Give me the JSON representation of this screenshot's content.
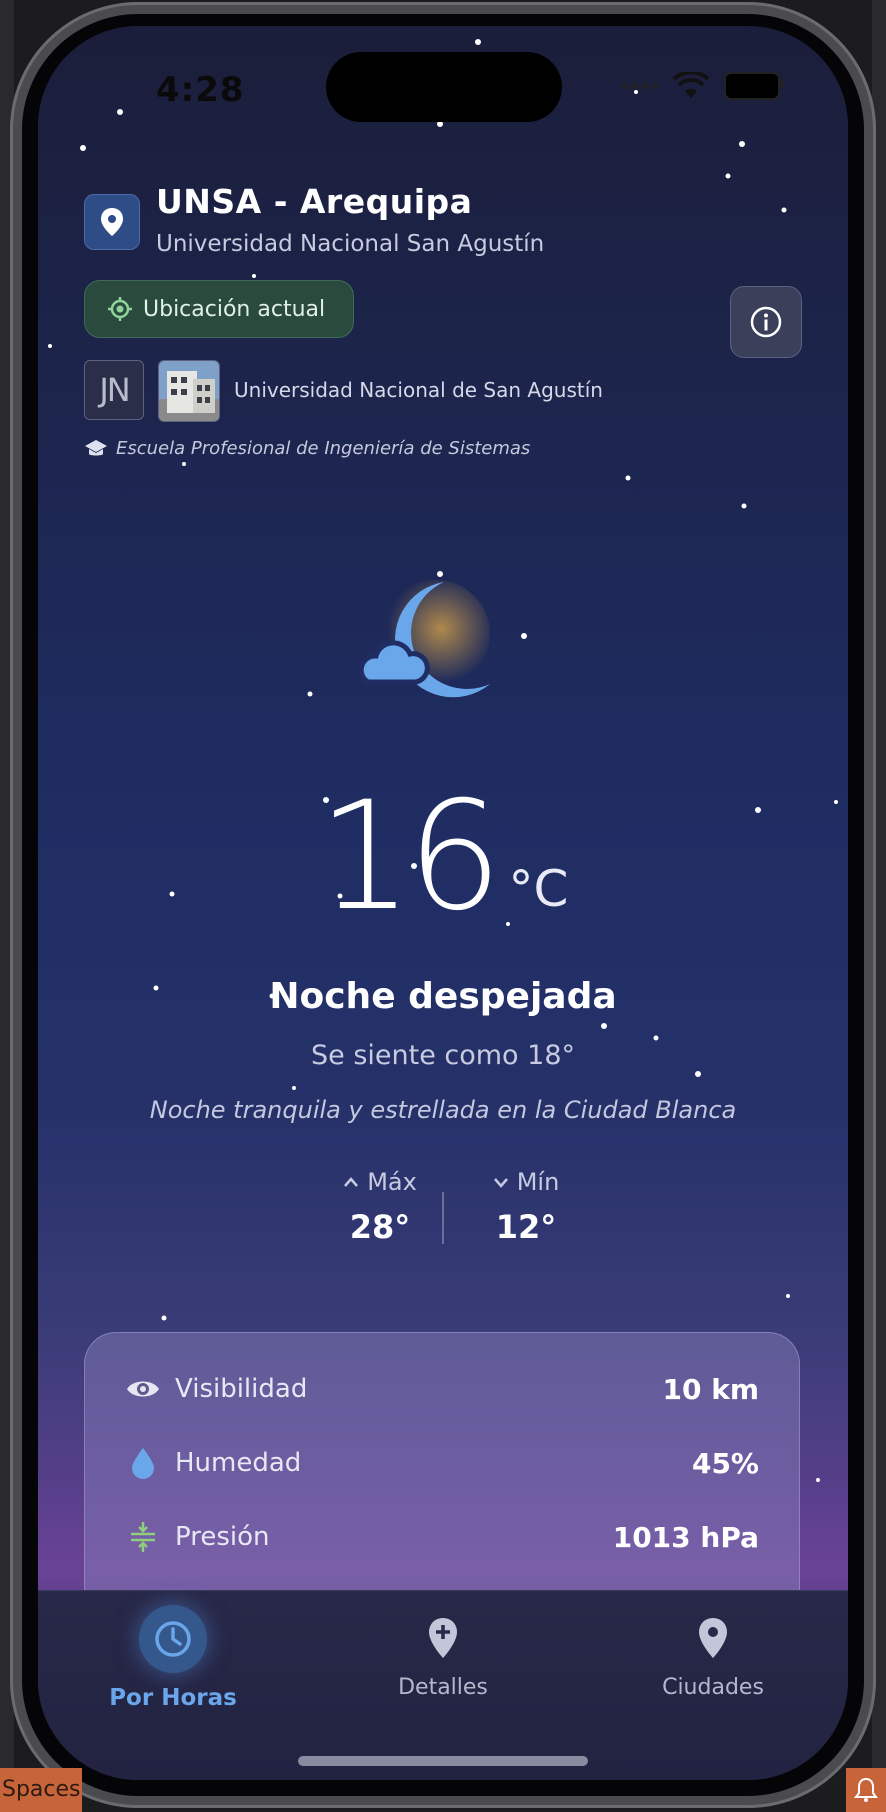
{
  "status": {
    "time": "4:28"
  },
  "header": {
    "title": "UNSA - Arequipa",
    "subtitle": "Universidad Nacional San Agustín",
    "location_chip": "Ubicación actual",
    "logo_text": "JN",
    "university": "Universidad Nacional de San Agustín",
    "school": "Escuela Profesional de Ingeniería de Sistemas"
  },
  "weather": {
    "temperature": "16",
    "unit": "°C",
    "condition": "Noche despejada",
    "feels_like": "Se siente como 18°",
    "description": "Noche tranquila y estrellada en la Ciudad Blanca",
    "max_label": "Máx",
    "max_value": "28°",
    "min_label": "Mín",
    "min_value": "12°"
  },
  "details": [
    {
      "icon": "eye-icon",
      "label": "Visibilidad",
      "value": "10 km",
      "color": "#e6e6f2"
    },
    {
      "icon": "water-drop-icon",
      "label": "Humedad",
      "value": "45%",
      "color": "#6aa6ea"
    },
    {
      "icon": "compress-icon",
      "label": "Presión",
      "value": "1013 hPa",
      "color": "#8fcf7a"
    }
  ],
  "nav": [
    {
      "label": "Por Horas",
      "icon": "clock-icon",
      "active": true
    },
    {
      "label": "Detalles",
      "icon": "add-location-icon",
      "active": false
    },
    {
      "label": "Ciudades",
      "icon": "location-pin-icon",
      "active": false
    }
  ],
  "desktop": {
    "spaces_label": "Spaces"
  },
  "colors": {
    "accent": "#6aa6ea",
    "chip_bg": "#2b4a3e",
    "moon": "#6aa6ea"
  }
}
